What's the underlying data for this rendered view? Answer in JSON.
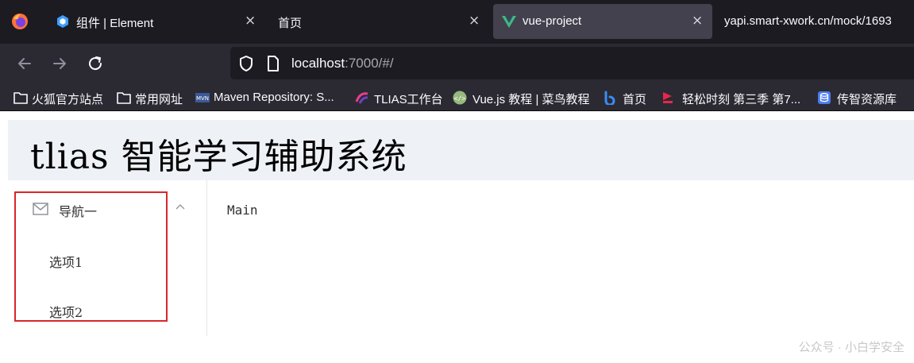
{
  "browser": {
    "tabs": [
      {
        "title": "组件 | Element",
        "icon": "element-logo-icon"
      },
      {
        "title": "首页",
        "icon": "none"
      },
      {
        "title": "vue-project",
        "icon": "vue-logo-icon"
      },
      {
        "title": "yapi.smart-xwork.cn/mock/1693"
      }
    ],
    "close_glyph": "×",
    "url_host": "localhost",
    "url_rest": ":7000/#/",
    "bookmarks": [
      {
        "label": "火狐官方站点",
        "icon": "folder-icon"
      },
      {
        "label": "常用网址",
        "icon": "folder-icon"
      },
      {
        "label": "Maven Repository: S...",
        "icon": "maven-icon"
      },
      {
        "label": "TLIAS工作台",
        "icon": "tlias-icon"
      },
      {
        "label": "Vue.js 教程 | 菜鸟教程",
        "icon": "runoob-icon"
      },
      {
        "label": "首页",
        "icon": "bilibili-icon"
      },
      {
        "label": "轻松时刻 第三季 第7...",
        "icon": "video-icon"
      },
      {
        "label": "传智资源库",
        "icon": "database-icon"
      }
    ]
  },
  "app": {
    "header_title": "tlias 智能学习辅助系统",
    "menu": {
      "submenu_label": "导航一",
      "items": [
        "选项1",
        "选项2"
      ]
    },
    "main_text": "Main"
  },
  "watermark": "公众号 · 小白学安全",
  "colors": {
    "header_bg": "#eef1f6",
    "highlight_border": "#d9262a",
    "tab_bar": "#1c1b22",
    "toolbar": "#2b2a33"
  }
}
